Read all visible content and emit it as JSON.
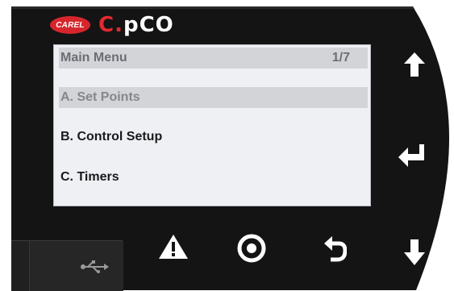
{
  "device": {
    "logo_badge": "CAREL",
    "brand_prefix": "C.",
    "brand_suffix": "pCO"
  },
  "screen": {
    "header_title": "Main Menu",
    "page_indicator": "1/7",
    "menu_items": [
      {
        "label": "A.  Set Points",
        "selected": true
      },
      {
        "label": "B. Control Setup",
        "selected": false
      },
      {
        "label": "C. Timers",
        "selected": false
      }
    ]
  },
  "buttons": {
    "up": "arrow-up-icon",
    "enter": "enter-icon",
    "down": "arrow-down-icon",
    "alarm": "warning-icon",
    "program": "program-icon",
    "escape": "escape-icon"
  },
  "colors": {
    "bezel": "#151515",
    "carel_red": "#d6262d",
    "screen_bg": "#eef0f4",
    "highlight_bar": "#d2d4d8"
  }
}
